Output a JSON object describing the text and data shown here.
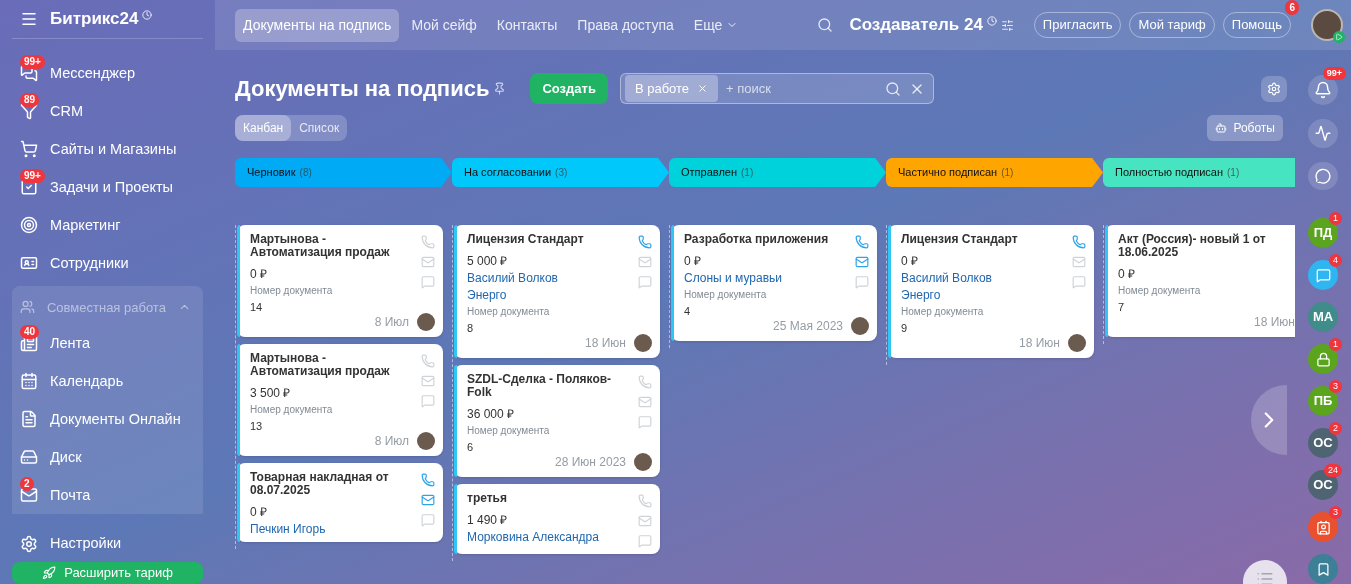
{
  "sidebar": {
    "logo": "Битрикс24",
    "items": [
      {
        "kind": "chat",
        "label": "Мессенджер",
        "badge": "99+"
      },
      {
        "kind": "funnel",
        "label": "CRM",
        "badge": "89"
      },
      {
        "kind": "cart",
        "label": "Сайты и Магазины"
      },
      {
        "kind": "task",
        "label": "Задачи и Проекты",
        "badge": "99+"
      },
      {
        "kind": "target",
        "label": "Маркетинг"
      },
      {
        "kind": "id",
        "label": "Сотрудники"
      }
    ],
    "group": {
      "label": "Совместная работа",
      "expanded": true,
      "items": [
        {
          "kind": "feed",
          "label": "Лента",
          "badge": "40"
        },
        {
          "kind": "calendar",
          "label": "Календарь"
        },
        {
          "kind": "doc",
          "label": "Документы Онлайн"
        },
        {
          "kind": "disk",
          "label": "Диск"
        },
        {
          "kind": "mail",
          "label": "Почта",
          "badge": "2"
        }
      ]
    },
    "settings": "Настройки",
    "upgrade_button": "Расширить тариф"
  },
  "top_nav": {
    "tabs": [
      {
        "label": "Документы на подпись",
        "selected": true
      },
      {
        "label": "Мой сейф",
        "selected": false
      },
      {
        "label": "Контакты",
        "selected": false
      },
      {
        "label": "Права доступа",
        "selected": false
      },
      {
        "label": "Еще",
        "selected": false
      }
    ],
    "brand": "Создаватель 24",
    "buttons": [
      {
        "label": "Пригласить"
      },
      {
        "label": "Мой тариф"
      },
      {
        "label": "Помощь",
        "badge": "6"
      }
    ]
  },
  "page": {
    "title": "Документы на подпись",
    "create_button": "Создать",
    "filter_tag": "В работе",
    "search_placeholder": "+ поиск",
    "views": [
      {
        "label": "Канбан",
        "selected": true
      },
      {
        "label": "Список",
        "selected": false
      }
    ],
    "robots_button": "Роботы"
  },
  "columns": [
    {
      "title": "Черновик",
      "count": "(8)",
      "color": "#00aaf5",
      "cards": [
        {
          "title": "Мартынова - Автоматизация продаж",
          "amount": "0 ₽",
          "doc_label": "Номер документа",
          "doc_number": "14",
          "date": "8 Июл",
          "phone_active": false,
          "mail_active": false,
          "avatar": true
        },
        {
          "title": "Мартынова - Автоматизация продаж",
          "amount": "3 500 ₽",
          "doc_label": "Номер документа",
          "doc_number": "13",
          "date": "8 Июл",
          "phone_active": false,
          "mail_active": false,
          "avatar": true
        },
        {
          "title": "Товарная накладная от 08.07.2025",
          "amount": "0 ₽",
          "contacts": [
            "Печкин Игорь"
          ],
          "phone_active": true,
          "mail_active": true
        }
      ]
    },
    {
      "title": "На согласовании",
      "count": "(3)",
      "color": "#00c8fa",
      "cards": [
        {
          "title": "Лицензия Стандарт",
          "amount": "5 000 ₽",
          "contacts": [
            "Василий Волков",
            "Энерго"
          ],
          "doc_label": "Номер документа",
          "doc_number": "8",
          "date": "18 Июн",
          "phone_active": true,
          "mail_active": false,
          "avatar": true
        },
        {
          "title": "SZDL-Сделка - Поляков-Folk",
          "amount": "36 000 ₽",
          "doc_label": "Номер документа",
          "doc_number": "6",
          "date": "28 Июн 2023",
          "phone_active": false,
          "mail_active": false,
          "avatar": true
        },
        {
          "title": "третья",
          "amount": "1 490 ₽",
          "contacts": [
            "Морковина Александра"
          ],
          "phone_active": false,
          "mail_active": false
        }
      ]
    },
    {
      "title": "Отправлен",
      "count": "(1)",
      "color": "#00d2dc",
      "cards": [
        {
          "title": "Разработка приложения",
          "amount": "0 ₽",
          "contacts": [
            "Слоны и муравьи"
          ],
          "doc_label": "Номер документа",
          "doc_number": "4",
          "date": "25 Мая 2023",
          "phone_active": true,
          "mail_active": true,
          "avatar": true
        }
      ]
    },
    {
      "title": "Частично подписан",
      "count": "(1)",
      "color": "#ffa500",
      "cards": [
        {
          "title": "Лицензия Стандарт",
          "amount": "0 ₽",
          "contacts": [
            "Василий Волков",
            "Энерго"
          ],
          "doc_label": "Номер документа",
          "doc_number": "9",
          "date": "18 Июн",
          "phone_active": true,
          "mail_active": false,
          "avatar": true
        }
      ]
    },
    {
      "title": "Полностью подписан",
      "count": "(1)",
      "color": "#47e4c2",
      "cards": [
        {
          "title": "Акт (Россия)- новый 1 от 18.06.2025",
          "amount": "0 ₽",
          "doc_label": "Номер документа",
          "doc_number": "7",
          "date": "18 Июн",
          "avatar": false
        }
      ]
    }
  ],
  "right_rail": {
    "bell_badge": "99+",
    "chats": [
      {
        "kind": "initials",
        "initials": "ПД",
        "color": "#5ba41e",
        "badge": "1"
      },
      {
        "kind": "chat",
        "color": "#2fb5f0",
        "badge": "4"
      },
      {
        "kind": "initials",
        "initials": "МА",
        "color": "#3f8c8a"
      },
      {
        "kind": "lock",
        "color": "#5ba41e",
        "badge": "1"
      },
      {
        "kind": "initials",
        "initials": "ПБ",
        "color": "#5ba41e",
        "badge": "3"
      },
      {
        "kind": "initials",
        "initials": "ОС",
        "color": "#4f6473",
        "badge": "2"
      },
      {
        "kind": "initials",
        "initials": "ОС",
        "color": "#4f6473",
        "badge": "24"
      },
      {
        "kind": "card",
        "color": "#e8502e",
        "badge": "3"
      },
      {
        "kind": "bookmark",
        "color": "#3d7f96"
      }
    ]
  }
}
